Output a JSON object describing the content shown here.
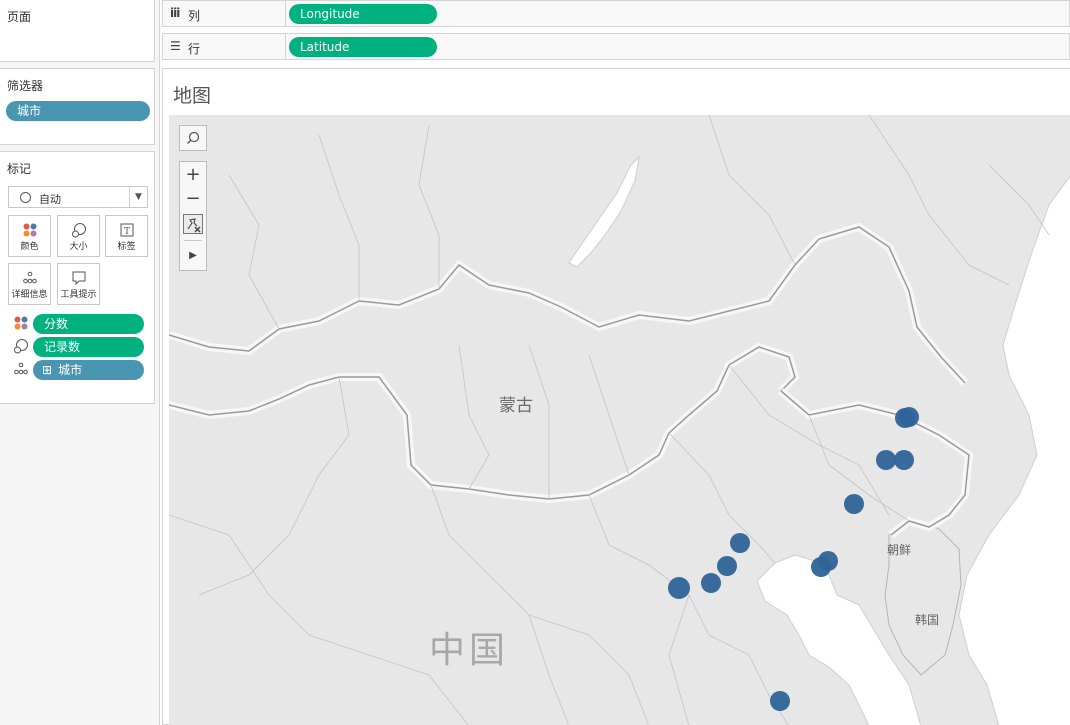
{
  "pages_panel": {
    "title": "页面"
  },
  "shelves": {
    "columns": {
      "label": "列",
      "icon": "columns-icon",
      "pill": "Longitude"
    },
    "rows": {
      "label": "行",
      "icon": "rows-icon",
      "pill": "Latitude"
    }
  },
  "filters_panel": {
    "title": "筛选器",
    "items": [
      "城市"
    ]
  },
  "marks_panel": {
    "title": "标记",
    "mark_type": "自动",
    "buttons": [
      {
        "label": "颜色",
        "icon": "color-icon"
      },
      {
        "label": "大小",
        "icon": "size-icon"
      },
      {
        "label": "标签",
        "icon": "label-icon"
      },
      {
        "label": "详细信息",
        "icon": "detail-icon"
      },
      {
        "label": "工具提示",
        "icon": "tooltip-icon"
      }
    ],
    "fields": [
      {
        "pill": "分数",
        "encoding": "color-icon"
      },
      {
        "pill": "记录数",
        "encoding": "size-icon"
      },
      {
        "pill": "城市",
        "encoding": "detail-icon",
        "prefix": "⊞"
      }
    ]
  },
  "sheet": {
    "title": "地图"
  },
  "map_labels": {
    "mongolia": "蒙古",
    "china": "中国",
    "north_korea": "朝鲜",
    "south_korea": "韩国"
  },
  "map_tools": [
    "search-icon",
    "zoom-in-icon",
    "zoom-out-icon",
    "pin-icon",
    "expand-icon"
  ],
  "colors": {
    "green_pill": "#00b180",
    "blue_pill": "#4996b2",
    "mark": "#2f6398",
    "map_land": "#e7e7e7",
    "map_water": "#ffffff",
    "border": "#999999"
  }
}
